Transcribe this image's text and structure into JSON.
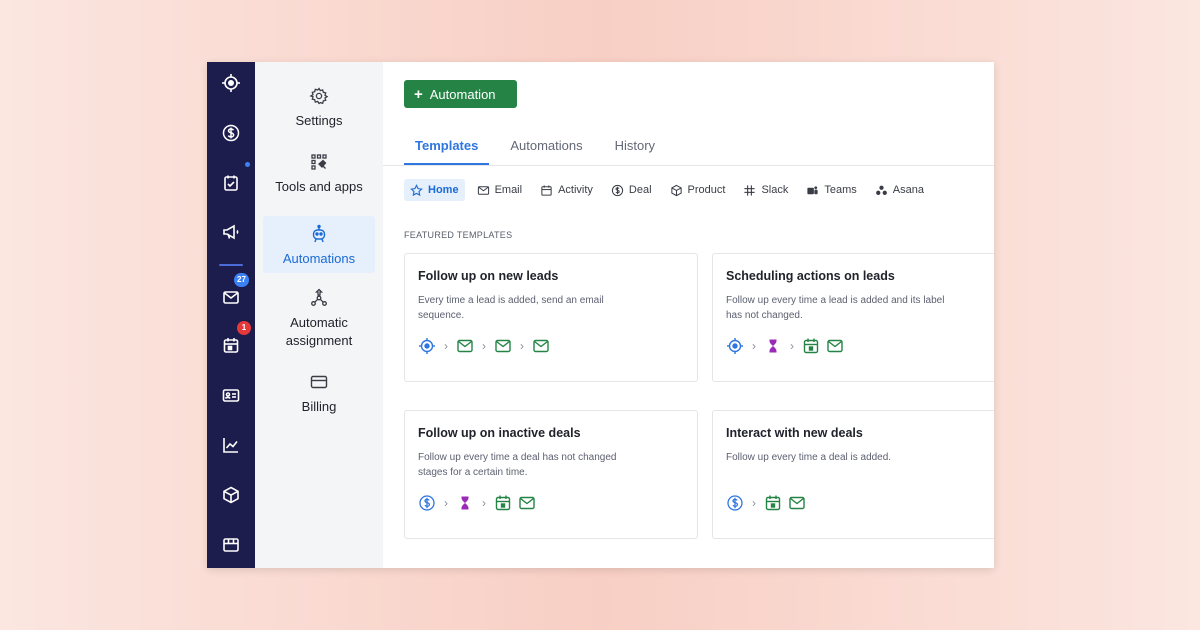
{
  "rail": {
    "icons": [
      "target-icon",
      "dollar-icon",
      "tasks-icon",
      "megaphone-icon",
      "mail-icon",
      "calendar-icon",
      "contact-card-icon",
      "chart-icon",
      "box-icon",
      "store-icon"
    ],
    "mail_badge": "27",
    "calendar_badge": "1",
    "colors": {
      "bg": "#1d1d4d",
      "badge_mail": "#3b82f6",
      "badge_cal": "#e5383b"
    }
  },
  "panel": {
    "items": [
      {
        "label": "Settings",
        "icon": "gear-icon"
      },
      {
        "label": "Tools and apps",
        "icon": "tools-icon"
      },
      {
        "label": "Automations",
        "icon": "robot-icon"
      },
      {
        "label": "Automatic\nassignment",
        "icon": "assignment-icon"
      },
      {
        "label": "Billing",
        "icon": "credit-card-icon"
      }
    ]
  },
  "toolbar": {
    "add_label": "Automation",
    "add_color": "#258445"
  },
  "tabs": [
    "Templates",
    "Automations",
    "History"
  ],
  "chips": [
    "Home",
    "Email",
    "Activity",
    "Deal",
    "Product",
    "Slack",
    "Teams",
    "Asana"
  ],
  "section_title": "FEATURED TEMPLATES",
  "cards": [
    {
      "title": "Follow up on new leads",
      "desc": "Every time a lead is added, send an email sequence."
    },
    {
      "title": "Scheduling actions on leads",
      "desc": "Follow up every time a lead is added and its label has not changed."
    },
    {
      "title": "Follow up on inactive deals",
      "desc": "Follow up every time a deal has not changed stages for a certain time."
    },
    {
      "title": "Interact with new deals",
      "desc": "Follow up every time a deal is added."
    }
  ]
}
